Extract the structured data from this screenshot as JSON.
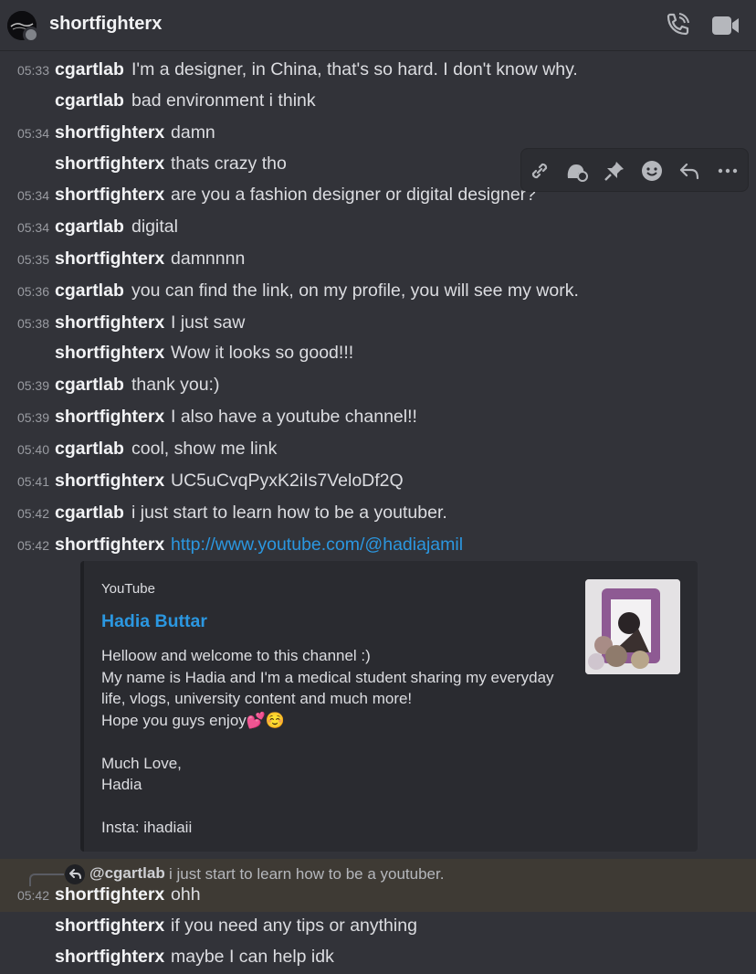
{
  "header": {
    "title": "shortfighterx",
    "call_icon": "phone-call-icon",
    "video_icon": "video-camera-icon"
  },
  "messages": [
    {
      "time": "05:33",
      "author": "cgartlab",
      "text": "I'm a designer, in China, that's so hard. I don't know why."
    },
    {
      "time": "",
      "author": "cgartlab",
      "text": "bad environment i think"
    },
    {
      "time": "05:34",
      "author": "shortfighterx",
      "text": "damn"
    },
    {
      "time": "",
      "author": "shortfighterx",
      "text": "thats crazy tho"
    },
    {
      "time": "05:34",
      "author": "shortfighterx",
      "text": "are you a fashion designer or digital designer?"
    },
    {
      "time": "05:34",
      "author": "cgartlab",
      "text": "digital"
    },
    {
      "time": "05:35",
      "author": "shortfighterx",
      "text": "damnnnn"
    },
    {
      "time": "05:36",
      "author": "cgartlab",
      "text": "you can find the link, on my profile, you will see my work."
    },
    {
      "time": "05:38",
      "author": "shortfighterx",
      "text": "I just saw"
    },
    {
      "time": "",
      "author": "shortfighterx",
      "text": "Wow it looks so good!!!"
    },
    {
      "time": "05:39",
      "author": "cgartlab",
      "text": "thank you:)"
    },
    {
      "time": "05:39",
      "author": "shortfighterx",
      "text": "I also have a youtube channel!!"
    },
    {
      "time": "05:40",
      "author": "cgartlab",
      "text": "cool, show me link"
    },
    {
      "time": "05:41",
      "author": "shortfighterx",
      "text": "UC5uCvqPyxK2iIs7VeloDf2Q"
    },
    {
      "time": "05:42",
      "author": "cgartlab",
      "text": "i just start to learn how to be a youtuber."
    },
    {
      "time": "05:42",
      "author": "shortfighterx",
      "text": "http://www.youtube.com/@hadiajamil"
    }
  ],
  "toolbar": {
    "icons": [
      "link-icon",
      "thread-icon",
      "pin-icon",
      "emoji-icon",
      "reply-icon",
      "more-icon"
    ]
  },
  "embed": {
    "provider": "YouTube",
    "title": "Hadia Buttar",
    "description": [
      "Helloow and welcome to this channel :)",
      "My name is Hadia and I'm a medical student sharing my everyday",
      "life, vlogs, university content and much more!",
      "Hope you guys enjoy💕☺️",
      "",
      "Much Love,",
      "Hadia",
      "",
      "Insta: ihadiaii"
    ]
  },
  "reply": {
    "reference_author": "@cgartlab",
    "reference_text": "i just start to learn how to be a youtuber.",
    "time": "05:42",
    "author": "shortfighterx",
    "text": "ohh"
  },
  "after": [
    {
      "author": "shortfighterx",
      "text": "if you need any tips or anything"
    },
    {
      "author": "shortfighterx",
      "text": "maybe I can help idk"
    }
  ],
  "colors": {
    "background": "#323339",
    "link": "#2b97e0",
    "mention_highlight": "#3e3a34"
  }
}
